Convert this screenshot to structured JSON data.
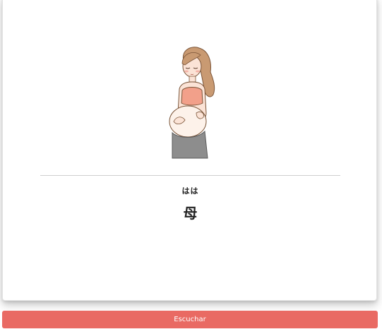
{
  "flashcard": {
    "image_subject": "pregnant-woman-illustration",
    "reading": "はは",
    "kanji": "母"
  },
  "actions": {
    "listen_label": "Escuchar"
  },
  "colors": {
    "button_background": "#e96a63",
    "button_text": "#ffffff",
    "divider": "#cfcfcf",
    "text": "#222222"
  }
}
